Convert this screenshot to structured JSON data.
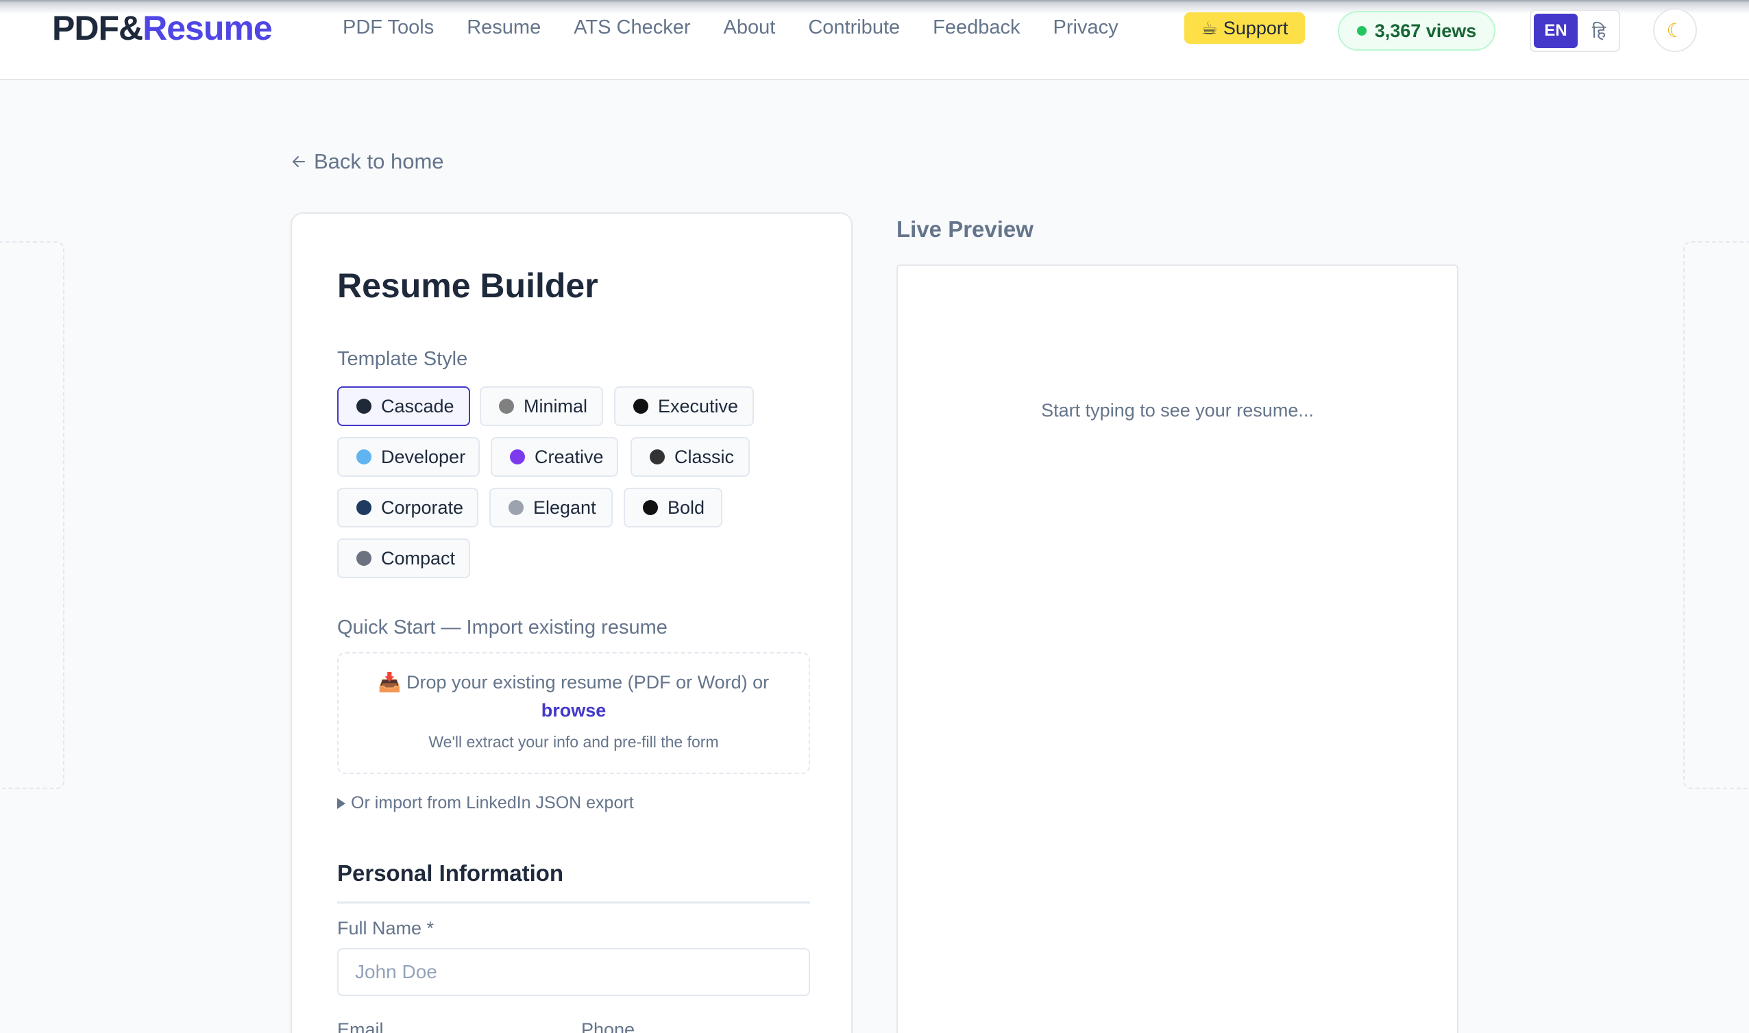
{
  "header": {
    "logo_part1": "PDF&",
    "logo_part2": "Resume",
    "nav": [
      "PDF Tools",
      "Resume",
      "ATS Checker",
      "About",
      "Contribute",
      "Feedback",
      "Privacy"
    ],
    "support_label": "Support",
    "views_label": "3,367 views",
    "lang_en": "EN",
    "lang_hi": "हि"
  },
  "back_label": "Back to home",
  "builder": {
    "title": "Resume Builder",
    "template_style_label": "Template Style",
    "templates": [
      {
        "name": "Cascade",
        "color": "#1f2937"
      },
      {
        "name": "Minimal",
        "color": "#808080"
      },
      {
        "name": "Executive",
        "color": "#111111"
      },
      {
        "name": "Developer",
        "color": "#60b4f0"
      },
      {
        "name": "Creative",
        "color": "#7c3aed"
      },
      {
        "name": "Classic",
        "color": "#333333"
      },
      {
        "name": "Corporate",
        "color": "#1e3a5f"
      },
      {
        "name": "Elegant",
        "color": "#9ca3af"
      },
      {
        "name": "Bold",
        "color": "#111111"
      },
      {
        "name": "Compact",
        "color": "#6b7280"
      }
    ],
    "selected_template": "Cascade",
    "quick_start_label": "Quick Start — Import existing resume",
    "drop_text": "Drop your existing resume (PDF or Word) or",
    "browse_label": "browse",
    "drop_subtext": "We'll extract your info and pre-fill the form",
    "linkedin_label": "Or import from LinkedIn JSON export",
    "personal_info_title": "Personal Information",
    "full_name_label": "Full Name *",
    "full_name_placeholder": "John Doe",
    "email_label": "Email",
    "phone_label": "Phone"
  },
  "preview": {
    "title": "Live Preview",
    "empty_message": "Start typing to see your resume..."
  },
  "colors": {
    "accent": "#4338ca",
    "support_bg": "#fde047",
    "views_bg": "#f0fdf4"
  }
}
